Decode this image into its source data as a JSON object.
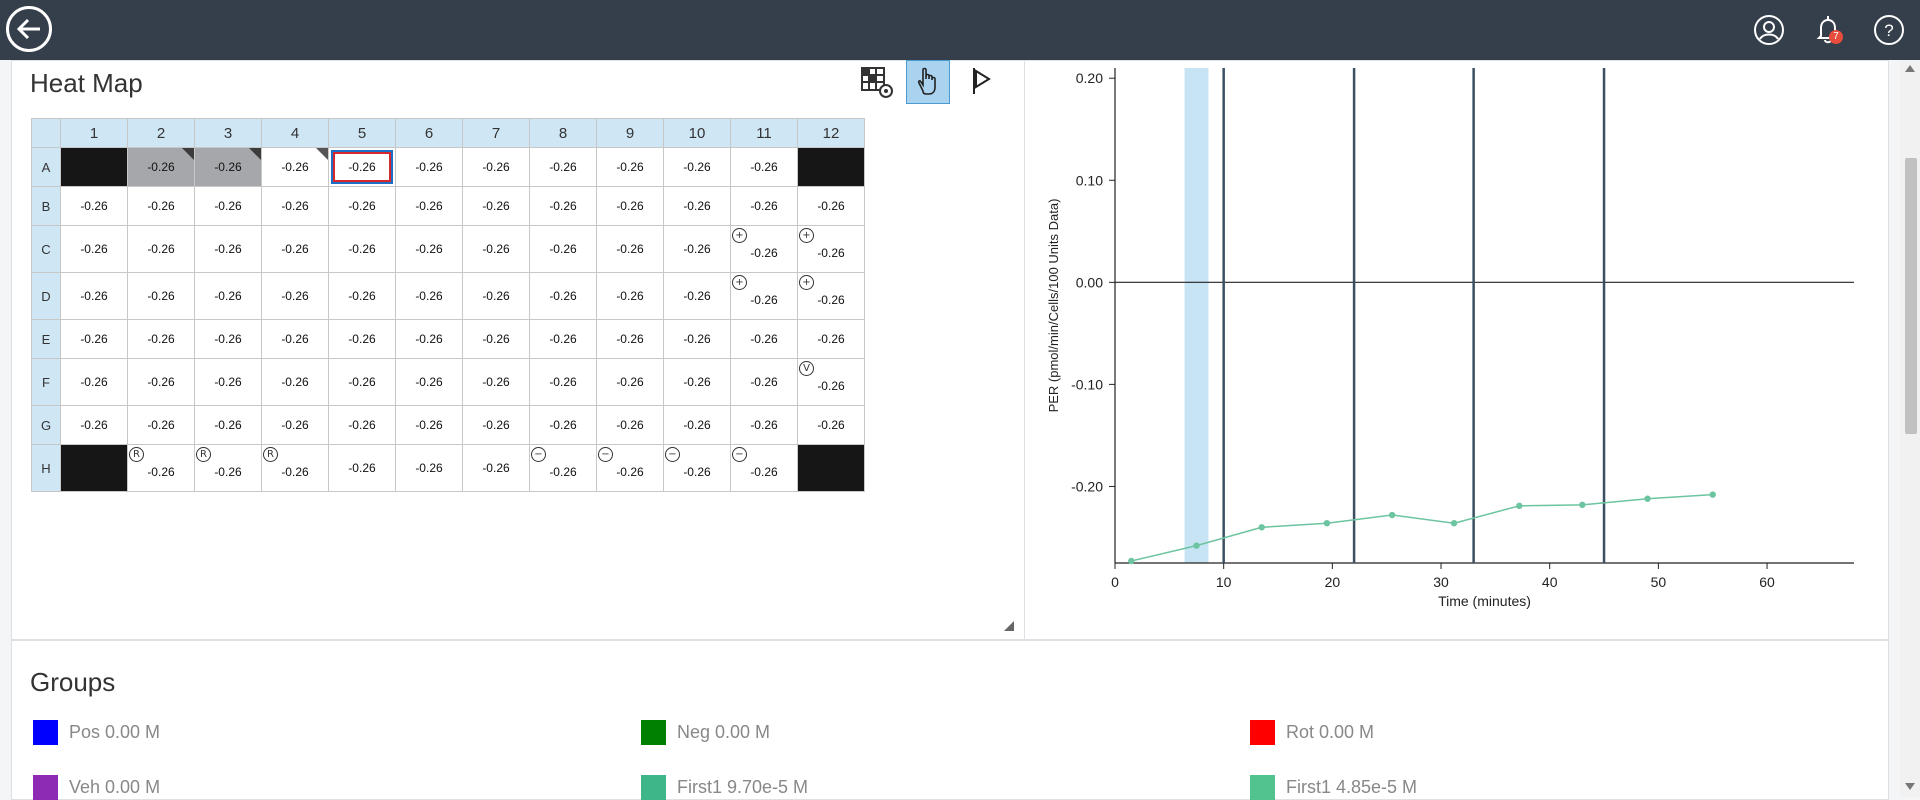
{
  "topbar": {
    "back_icon": "back-arrow-icon",
    "icons": [
      "user-icon",
      "bell-icon",
      "help-icon"
    ],
    "notification_count": "7"
  },
  "heatmap": {
    "title": "Heat Map",
    "toolbar": [
      "heatmap-settings-icon",
      "hand-pointer-icon",
      "flag-icon"
    ],
    "columns": [
      "1",
      "2",
      "3",
      "4",
      "5",
      "6",
      "7",
      "8",
      "9",
      "10",
      "11",
      "12"
    ],
    "rows": [
      {
        "label": "A",
        "cells": [
          {
            "v": "",
            "s": "black"
          },
          {
            "v": "-0.26",
            "s": "grey",
            "tri": true
          },
          {
            "v": "-0.26",
            "s": "grey",
            "tri": true
          },
          {
            "v": "-0.26",
            "tri": true
          },
          {
            "v": "-0.26",
            "sel": true
          },
          {
            "v": "-0.26"
          },
          {
            "v": "-0.26"
          },
          {
            "v": "-0.26"
          },
          {
            "v": "-0.26"
          },
          {
            "v": "-0.26"
          },
          {
            "v": "-0.26"
          },
          {
            "v": "",
            "s": "black"
          }
        ]
      },
      {
        "label": "B",
        "cells": [
          {
            "v": "-0.26"
          },
          {
            "v": "-0.26"
          },
          {
            "v": "-0.26"
          },
          {
            "v": "-0.26"
          },
          {
            "v": "-0.26"
          },
          {
            "v": "-0.26"
          },
          {
            "v": "-0.26"
          },
          {
            "v": "-0.26"
          },
          {
            "v": "-0.26"
          },
          {
            "v": "-0.26"
          },
          {
            "v": "-0.26"
          },
          {
            "v": "-0.26"
          }
        ]
      },
      {
        "label": "C",
        "cells": [
          {
            "v": "-0.26"
          },
          {
            "v": "-0.26"
          },
          {
            "v": "-0.26"
          },
          {
            "v": "-0.26"
          },
          {
            "v": "-0.26"
          },
          {
            "v": "-0.26"
          },
          {
            "v": "-0.26"
          },
          {
            "v": "-0.26"
          },
          {
            "v": "-0.26"
          },
          {
            "v": "-0.26"
          },
          {
            "v": "-0.26",
            "m": "+"
          },
          {
            "v": "-0.26",
            "m": "+"
          }
        ]
      },
      {
        "label": "D",
        "cells": [
          {
            "v": "-0.26"
          },
          {
            "v": "-0.26"
          },
          {
            "v": "-0.26"
          },
          {
            "v": "-0.26"
          },
          {
            "v": "-0.26"
          },
          {
            "v": "-0.26"
          },
          {
            "v": "-0.26"
          },
          {
            "v": "-0.26"
          },
          {
            "v": "-0.26"
          },
          {
            "v": "-0.26"
          },
          {
            "v": "-0.26",
            "m": "+"
          },
          {
            "v": "-0.26",
            "m": "+"
          }
        ]
      },
      {
        "label": "E",
        "cells": [
          {
            "v": "-0.26"
          },
          {
            "v": "-0.26"
          },
          {
            "v": "-0.26"
          },
          {
            "v": "-0.26"
          },
          {
            "v": "-0.26"
          },
          {
            "v": "-0.26"
          },
          {
            "v": "-0.26"
          },
          {
            "v": "-0.26"
          },
          {
            "v": "-0.26"
          },
          {
            "v": "-0.26"
          },
          {
            "v": "-0.26"
          },
          {
            "v": "-0.26"
          }
        ]
      },
      {
        "label": "F",
        "cells": [
          {
            "v": "-0.26"
          },
          {
            "v": "-0.26"
          },
          {
            "v": "-0.26"
          },
          {
            "v": "-0.26"
          },
          {
            "v": "-0.26"
          },
          {
            "v": "-0.26"
          },
          {
            "v": "-0.26"
          },
          {
            "v": "-0.26"
          },
          {
            "v": "-0.26"
          },
          {
            "v": "-0.26"
          },
          {
            "v": "-0.26"
          },
          {
            "v": "-0.26",
            "m": "V"
          }
        ]
      },
      {
        "label": "G",
        "cells": [
          {
            "v": "-0.26"
          },
          {
            "v": "-0.26"
          },
          {
            "v": "-0.26"
          },
          {
            "v": "-0.26"
          },
          {
            "v": "-0.26"
          },
          {
            "v": "-0.26"
          },
          {
            "v": "-0.26"
          },
          {
            "v": "-0.26"
          },
          {
            "v": "-0.26"
          },
          {
            "v": "-0.26"
          },
          {
            "v": "-0.26"
          },
          {
            "v": "-0.26"
          }
        ]
      },
      {
        "label": "H",
        "cells": [
          {
            "v": "",
            "s": "black"
          },
          {
            "v": "-0.26",
            "m": "R"
          },
          {
            "v": "-0.26",
            "m": "R"
          },
          {
            "v": "-0.26",
            "m": "R"
          },
          {
            "v": "-0.26"
          },
          {
            "v": "-0.26"
          },
          {
            "v": "-0.26"
          },
          {
            "v": "-0.26",
            "m": "−"
          },
          {
            "v": "-0.26",
            "m": "−"
          },
          {
            "v": "-0.26",
            "m": "−"
          },
          {
            "v": "-0.26",
            "m": "−"
          },
          {
            "v": "",
            "s": "black"
          }
        ]
      }
    ]
  },
  "chart_data": {
    "type": "line",
    "title": "",
    "xlabel": "Time (minutes)",
    "ylabel": "PER (pmol/min/Cells/100 Units Data)",
    "xlim": [
      0,
      68
    ],
    "ylim": [
      -0.275,
      0.21
    ],
    "x_ticks": [
      "0",
      "10",
      "20",
      "30",
      "40",
      "50",
      "60"
    ],
    "y_ticks": [
      "0.20",
      "0.10",
      "0.00",
      "-0.10",
      "-0.20"
    ],
    "y_tick_values": [
      0.2,
      0.1,
      0.0,
      -0.1,
      -0.2
    ],
    "x_tick_values": [
      0,
      10,
      20,
      30,
      40,
      50,
      60
    ],
    "injection_lines": [
      10,
      22,
      33,
      45
    ],
    "highlight_band": [
      6.4,
      8.6
    ],
    "series": [
      {
        "color": "#6cc4a0",
        "x": [
          1.5,
          7.5,
          13.5,
          19.5,
          25.5,
          31.2,
          37.2,
          43.0,
          49.0,
          55.0
        ],
        "y": [
          -0.273,
          -0.258,
          -0.24,
          -0.236,
          -0.228,
          -0.236,
          -0.219,
          -0.218,
          -0.212,
          -0.208
        ]
      }
    ]
  },
  "groups": {
    "title": "Groups",
    "items": [
      {
        "label": "Pos 0.00 M",
        "color": "#0000ff"
      },
      {
        "label": "Neg 0.00 M",
        "color": "#008000"
      },
      {
        "label": "Rot 0.00 M",
        "color": "#ff0000"
      },
      {
        "label": "Veh 0.00 M",
        "color": "#8e2bb5"
      },
      {
        "label": "First1 9.70e-5 M",
        "color": "#3fb58a"
      },
      {
        "label": "First1 4.85e-5 M",
        "color": "#52c28f"
      }
    ]
  }
}
